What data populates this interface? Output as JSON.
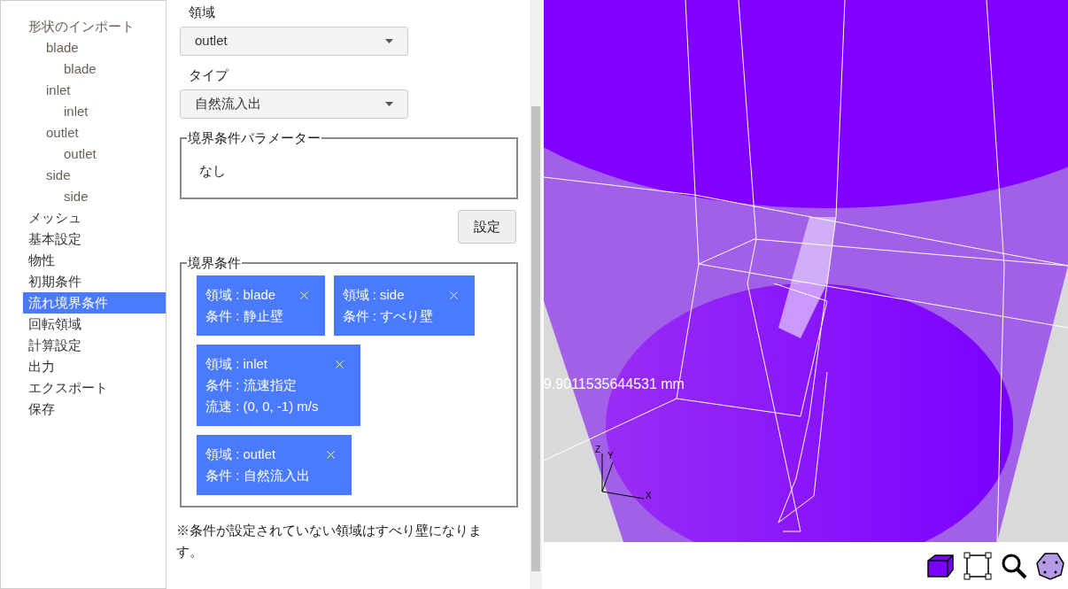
{
  "sidebar": {
    "items": [
      {
        "label": "形状のインポート",
        "selected": false,
        "children": [
          {
            "label": "blade",
            "selected": false,
            "children": [
              {
                "label": "blade",
                "selected": false
              }
            ]
          },
          {
            "label": "inlet",
            "selected": false,
            "children": [
              {
                "label": "inlet",
                "selected": false
              }
            ]
          },
          {
            "label": "outlet",
            "selected": false,
            "children": [
              {
                "label": "outlet",
                "selected": false
              }
            ]
          },
          {
            "label": "side",
            "selected": false,
            "children": [
              {
                "label": "side",
                "selected": false
              }
            ]
          }
        ]
      },
      {
        "label": "メッシュ",
        "selected": false
      },
      {
        "label": "基本設定",
        "selected": false
      },
      {
        "label": "物性",
        "selected": false
      },
      {
        "label": "初期条件",
        "selected": false
      },
      {
        "label": "流れ境界条件",
        "selected": true
      },
      {
        "label": "回転領域",
        "selected": false
      },
      {
        "label": "計算設定",
        "selected": false
      },
      {
        "label": "出力",
        "selected": false
      },
      {
        "label": "エクスポート",
        "selected": false
      },
      {
        "label": "保存",
        "selected": false
      }
    ]
  },
  "form": {
    "region": {
      "label": "領域",
      "value": "outlet"
    },
    "type": {
      "label": "タイプ",
      "value": "自然流入出"
    },
    "parameters": {
      "legend": "境界条件パラメーター",
      "text": "なし"
    },
    "set_button": "設定",
    "conditions": {
      "legend": "境界条件",
      "cards": [
        {
          "lines": [
            "領域 : blade",
            "条件 : 静止壁"
          ]
        },
        {
          "lines": [
            "領域 : side",
            "条件 : すべり壁"
          ]
        },
        {
          "lines": [
            "領域 : inlet",
            "条件 : 流速指定",
            "流速 : (0, 0, -1) m/s"
          ]
        },
        {
          "lines": [
            "領域 : outlet",
            "条件 : 自然流入出"
          ]
        }
      ]
    },
    "note": "※条件が設定されていない領域はすべり壁になります。"
  },
  "viewport": {
    "measurement": "9.9011535644531 mm",
    "axes": [
      "X",
      "Y",
      "Z"
    ]
  }
}
